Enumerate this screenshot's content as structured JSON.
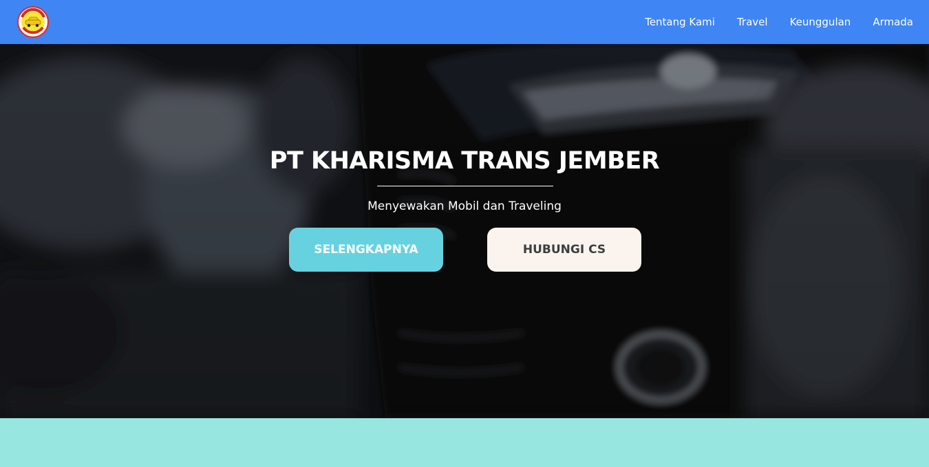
{
  "brand": {
    "logo_icon": "kharisma-trans-logo",
    "colors": {
      "navbar": "#3f85f4",
      "primary_button": "#67d2df",
      "secondary_button": "#fbf3ee",
      "section_band": "#98e6e0"
    }
  },
  "nav": {
    "items": [
      {
        "label": "Tentang Kami"
      },
      {
        "label": "Travel"
      },
      {
        "label": "Keunggulan"
      },
      {
        "label": "Armada"
      }
    ]
  },
  "hero": {
    "title": "PT KHARISMA TRANS JEMBER",
    "subtitle": "Menyewakan Mobil dan Traveling",
    "buttons": {
      "primary_label": "SELENGKAPNYA",
      "secondary_label": "HUBUNGI CS"
    }
  }
}
